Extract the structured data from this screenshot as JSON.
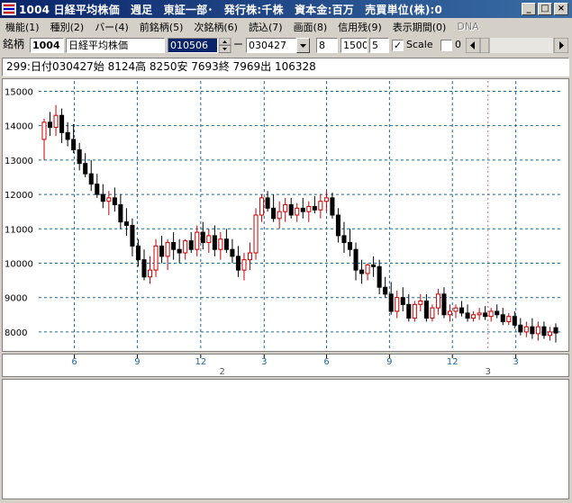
{
  "window": {
    "title": "1004 日経平均株価　週足　東証一部･　発行株:千株　資本金:百万　売買単位(株):0",
    "buttons": {
      "minimize": "_",
      "maximize": "□",
      "close": "×"
    }
  },
  "menu": [
    {
      "label": "機能(1)",
      "disabled": false
    },
    {
      "label": "種別(2)",
      "disabled": false
    },
    {
      "label": "バー(4)",
      "disabled": false
    },
    {
      "label": "前銘柄(5)",
      "disabled": false
    },
    {
      "label": "次銘柄(6)",
      "disabled": false
    },
    {
      "label": "読込(7)",
      "disabled": false
    },
    {
      "label": "画面(8)",
      "disabled": false
    },
    {
      "label": "信用残(9)",
      "disabled": false
    },
    {
      "label": "表示期間(0)",
      "disabled": false
    },
    {
      "label": "DNA",
      "disabled": true
    }
  ],
  "toolbar": {
    "label": "銘柄",
    "code": "1004",
    "name": "日経平均株価",
    "start_date": "010506",
    "dash": "ー",
    "end_date": "030427",
    "param1": "8",
    "param2": "1500",
    "param3": "5",
    "scale_label": "Scale",
    "scale_checked": true,
    "zero_label": "0",
    "zero_checked": false
  },
  "infobar": {
    "text": "299:日付030427始 8124高 8250安 7693終 7969出 106328"
  },
  "chart_data": {
    "type": "candlestick",
    "ylim": [
      7500,
      15300
    ],
    "yticks": [
      8000,
      9000,
      10000,
      11000,
      12000,
      13000,
      14000,
      15000
    ],
    "x_tick_labels": [
      "6",
      "9",
      "12",
      "3",
      "6",
      "9",
      "12",
      "3"
    ],
    "year_labels": [
      "2",
      "3"
    ],
    "colors": {
      "up": "#cc0000",
      "down": "#000000",
      "grid": "#1c6b9a",
      "axis_text": "#1c6b9a"
    },
    "candles": [
      [
        13600,
        14200,
        13000,
        14100
      ],
      [
        14100,
        14400,
        13700,
        13950
      ],
      [
        13950,
        14600,
        13700,
        14300
      ],
      [
        14300,
        14500,
        13500,
        13800
      ],
      [
        13800,
        14100,
        13400,
        13600
      ],
      [
        13600,
        14050,
        13200,
        13300
      ],
      [
        13300,
        13500,
        12700,
        12900
      ],
      [
        12900,
        13200,
        12500,
        12600
      ],
      [
        12600,
        13000,
        12100,
        12300
      ],
      [
        12300,
        12600,
        11900,
        12000
      ],
      [
        12000,
        12300,
        11600,
        11800
      ],
      [
        11800,
        12100,
        11400,
        11900
      ],
      [
        11900,
        12200,
        11500,
        11700
      ],
      [
        11700,
        12000,
        11000,
        11200
      ],
      [
        11200,
        11600,
        10800,
        11100
      ],
      [
        11100,
        11300,
        10200,
        10500
      ],
      [
        10500,
        10700,
        9900,
        10100
      ],
      [
        10100,
        10400,
        9500,
        9600
      ],
      [
        9600,
        10200,
        9400,
        9800
      ],
      [
        9800,
        10700,
        9600,
        10500
      ],
      [
        10500,
        10800,
        10000,
        10200
      ],
      [
        10200,
        10700,
        9800,
        10600
      ],
      [
        10600,
        10900,
        10100,
        10400
      ],
      [
        10400,
        10700,
        10000,
        10300
      ],
      [
        10300,
        10700,
        10100,
        10650
      ],
      [
        10650,
        10900,
        10300,
        10400
      ],
      [
        10400,
        11100,
        10200,
        10900
      ],
      [
        10900,
        11200,
        10400,
        10600
      ],
      [
        10600,
        11000,
        10300,
        10800
      ],
      [
        10800,
        11100,
        10200,
        10400
      ],
      [
        10400,
        10900,
        10100,
        10700
      ],
      [
        10700,
        11000,
        10300,
        10400
      ],
      [
        10400,
        10700,
        10000,
        10200
      ],
      [
        10200,
        10500,
        9600,
        9800
      ],
      [
        9800,
        10300,
        9500,
        10100
      ],
      [
        10100,
        10600,
        9800,
        10300
      ],
      [
        10300,
        11600,
        10100,
        11400
      ],
      [
        11400,
        12000,
        11200,
        11900
      ],
      [
        11900,
        12100,
        11500,
        11600
      ],
      [
        11600,
        12000,
        11200,
        11300
      ],
      [
        11300,
        11800,
        11000,
        11500
      ],
      [
        11500,
        11900,
        11200,
        11700
      ],
      [
        11700,
        11900,
        11300,
        11400
      ],
      [
        11400,
        11750,
        11200,
        11600
      ],
      [
        11600,
        11900,
        11300,
        11500
      ],
      [
        11500,
        11800,
        11200,
        11650
      ],
      [
        11650,
        11950,
        11450,
        11550
      ],
      [
        11550,
        12000,
        11300,
        11800
      ],
      [
        11800,
        12100,
        11500,
        11900
      ],
      [
        11900,
        12050,
        11300,
        11400
      ],
      [
        11400,
        11600,
        10600,
        10800
      ],
      [
        10800,
        11200,
        10300,
        10600
      ],
      [
        10600,
        11000,
        10200,
        10400
      ],
      [
        10400,
        10600,
        9500,
        9800
      ],
      [
        9800,
        10100,
        9400,
        9700
      ],
      [
        9700,
        10000,
        9500,
        9950
      ],
      [
        9950,
        10200,
        9600,
        9900
      ],
      [
        9900,
        10100,
        9100,
        9300
      ],
      [
        9300,
        9600,
        9000,
        9100
      ],
      [
        9100,
        9450,
        8500,
        8600
      ],
      [
        8600,
        9200,
        8400,
        9000
      ],
      [
        9000,
        9300,
        8600,
        8800
      ],
      [
        8800,
        9100,
        8300,
        8400
      ],
      [
        8400,
        8900,
        8300,
        8800
      ],
      [
        8800,
        9100,
        8600,
        8900
      ],
      [
        8900,
        9100,
        8300,
        8400
      ],
      [
        8400,
        8800,
        8300,
        8700
      ],
      [
        8700,
        9250,
        8500,
        9100
      ],
      [
        9100,
        9300,
        8400,
        8500
      ],
      [
        8500,
        8800,
        8300,
        8600
      ],
      [
        8600,
        8800,
        8400,
        8700
      ],
      [
        8700,
        8900,
        8450,
        8550
      ],
      [
        8550,
        8800,
        8300,
        8400
      ],
      [
        8400,
        8600,
        8300,
        8500
      ],
      [
        8500,
        8700,
        8350,
        8550
      ],
      [
        8550,
        8750,
        8350,
        8450
      ],
      [
        8450,
        8700,
        8300,
        8600
      ],
      [
        8600,
        8800,
        8400,
        8500
      ],
      [
        8500,
        8700,
        8200,
        8300
      ],
      [
        8300,
        8550,
        8200,
        8450
      ],
      [
        8450,
        8600,
        8100,
        8200
      ],
      [
        8200,
        8400,
        7900,
        8000
      ],
      [
        8000,
        8300,
        7850,
        8150
      ],
      [
        8150,
        8400,
        7800,
        7950
      ],
      [
        7950,
        8300,
        7750,
        8150
      ],
      [
        8150,
        8300,
        7800,
        7900
      ],
      [
        7900,
        8150,
        7750,
        8000
      ],
      [
        8124,
        8250,
        7693,
        7969
      ]
    ]
  }
}
